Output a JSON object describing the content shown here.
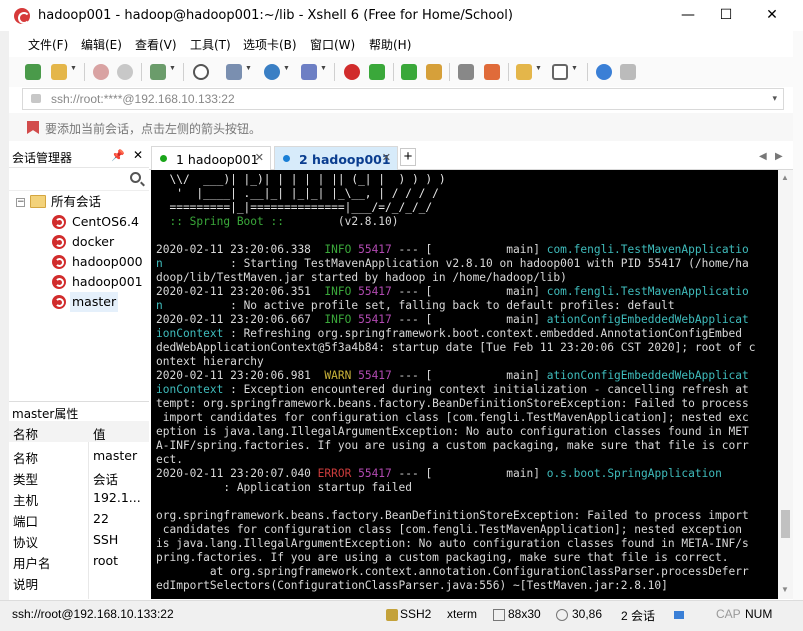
{
  "window": {
    "title": "hadoop001 - hadoop@hadoop001:~/lib - Xshell 6 (Free for Home/School)",
    "minimize": "—",
    "maximize": "☐",
    "close": "✕"
  },
  "menu": [
    "文件(F)",
    "编辑(E)",
    "查看(V)",
    "工具(T)",
    "选项卡(B)",
    "窗口(W)",
    "帮助(H)"
  ],
  "address": {
    "value": "ssh://root:****@192.168.10.133:22",
    "caret": "▾"
  },
  "hint": "要添加当前会话，点击左侧的箭头按钮。",
  "session_manager": {
    "title": "会话管理器",
    "pin": "📌",
    "close": "✕",
    "tree": {
      "root": "所有会话",
      "root_expander": "−",
      "items": [
        {
          "label": "CentOS6.4"
        },
        {
          "label": "docker"
        },
        {
          "label": "hadoop000"
        },
        {
          "label": "hadoop001"
        },
        {
          "label": "master"
        }
      ]
    }
  },
  "properties": {
    "title": "master属性",
    "header": {
      "name": "名称",
      "value": "值"
    },
    "rows": [
      {
        "name": "名称",
        "value": "master"
      },
      {
        "name": "类型",
        "value": "会话"
      },
      {
        "name": "主机",
        "value": "192.1..."
      },
      {
        "name": "端口",
        "value": "22"
      },
      {
        "name": "协议",
        "value": "SSH"
      },
      {
        "name": "用户名",
        "value": "root"
      },
      {
        "name": "说明",
        "value": ""
      }
    ]
  },
  "tabs": [
    {
      "label": "1 hadoop001",
      "close": "✕",
      "dot_color": "#1aa51a",
      "active": false
    },
    {
      "label": "2 hadoop001",
      "close": "✕",
      "dot_color": "#1a7fd6",
      "active": true
    }
  ],
  "tab_add": "+",
  "terminal": {
    "lines": [
      [
        {
          "t": "  \\\\/  ___)| |_)| | | | | || (_| |  ) ) ) )",
          "c": "c-banner"
        }
      ],
      [
        {
          "t": "   '  |____| .__|_| |_|_| |_\\__, | / / / /",
          "c": "c-banner"
        }
      ],
      [
        {
          "t": "  =========|_|==============|___/=/_/_/_/",
          "c": "c-banner"
        }
      ],
      [
        {
          "t": "  :: Spring Boot ::",
          "c": "c-green"
        },
        {
          "t": "        (v2.8.10)",
          "c": "c-gray"
        }
      ],
      [
        {
          "t": "",
          "c": "c-gray"
        }
      ],
      [
        {
          "t": "2020-02-11 23:20:06.338  ",
          "c": "c-gray"
        },
        {
          "t": "INFO",
          "c": "c-green"
        },
        {
          "t": " ",
          "c": "c-gray"
        },
        {
          "t": "55417",
          "c": "c-purple"
        },
        {
          "t": " --- [           main] ",
          "c": "c-gray"
        },
        {
          "t": "com.fengli.TestMavenApplicatio",
          "c": "c-cyan"
        }
      ],
      [
        {
          "t": "n",
          "c": "c-cyan"
        },
        {
          "t": "          : Starting TestMavenApplication v2.8.10 on hadoop001 with PID 55417 (/home/ha",
          "c": "c-gray"
        }
      ],
      [
        {
          "t": "doop/lib/TestMaven.jar started by hadoop in /home/hadoop/lib)",
          "c": "c-gray"
        }
      ],
      [
        {
          "t": "2020-02-11 23:20:06.351  ",
          "c": "c-gray"
        },
        {
          "t": "INFO",
          "c": "c-green"
        },
        {
          "t": " ",
          "c": "c-gray"
        },
        {
          "t": "55417",
          "c": "c-purple"
        },
        {
          "t": " --- [           main] ",
          "c": "c-gray"
        },
        {
          "t": "com.fengli.TestMavenApplicatio",
          "c": "c-cyan"
        }
      ],
      [
        {
          "t": "n",
          "c": "c-cyan"
        },
        {
          "t": "          : No active profile set, falling back to default profiles: default",
          "c": "c-gray"
        }
      ],
      [
        {
          "t": "2020-02-11 23:20:06.667  ",
          "c": "c-gray"
        },
        {
          "t": "INFO",
          "c": "c-green"
        },
        {
          "t": " ",
          "c": "c-gray"
        },
        {
          "t": "55417",
          "c": "c-purple"
        },
        {
          "t": " --- [           main] ",
          "c": "c-gray"
        },
        {
          "t": "ationConfigEmbeddedWebApplicat",
          "c": "c-cyan"
        }
      ],
      [
        {
          "t": "ionContext",
          "c": "c-cyan"
        },
        {
          "t": " : Refreshing org.springframework.boot.context.embedded.AnnotationConfigEmbed",
          "c": "c-gray"
        }
      ],
      [
        {
          "t": "dedWebApplicationContext@5f3a4b84: startup date [Tue Feb 11 23:20:06 CST 2020]; root of c",
          "c": "c-gray"
        }
      ],
      [
        {
          "t": "ontext hierarchy",
          "c": "c-gray"
        }
      ],
      [
        {
          "t": "2020-02-11 23:20:06.981  ",
          "c": "c-gray"
        },
        {
          "t": "WARN",
          "c": "c-yellow"
        },
        {
          "t": " ",
          "c": "c-gray"
        },
        {
          "t": "55417",
          "c": "c-purple"
        },
        {
          "t": " --- [           main] ",
          "c": "c-gray"
        },
        {
          "t": "ationConfigEmbeddedWebApplicat",
          "c": "c-cyan"
        }
      ],
      [
        {
          "t": "ionContext",
          "c": "c-cyan"
        },
        {
          "t": " : Exception encountered during context initialization - cancelling refresh at",
          "c": "c-gray"
        }
      ],
      [
        {
          "t": "tempt: org.springframework.beans.factory.BeanDefinitionStoreException: Failed to process",
          "c": "c-gray"
        }
      ],
      [
        {
          "t": " import candidates for configuration class [com.fengli.TestMavenApplication]; nested exc",
          "c": "c-gray"
        }
      ],
      [
        {
          "t": "eption is java.lang.IllegalArgumentException: No auto configuration classes found in MET",
          "c": "c-gray"
        }
      ],
      [
        {
          "t": "A-INF/spring.factories. If you are using a custom packaging, make sure that file is corr",
          "c": "c-gray"
        }
      ],
      [
        {
          "t": "ect.",
          "c": "c-gray"
        }
      ],
      [
        {
          "t": "2020-02-11 23:20:07.040 ",
          "c": "c-gray"
        },
        {
          "t": "ERROR",
          "c": "c-red"
        },
        {
          "t": " ",
          "c": "c-gray"
        },
        {
          "t": "55417",
          "c": "c-purple"
        },
        {
          "t": " --- [           main] ",
          "c": "c-gray"
        },
        {
          "t": "o.s.boot.SpringApplication",
          "c": "c-cyan"
        }
      ],
      [
        {
          "t": "          : Application startup failed",
          "c": "c-gray"
        }
      ],
      [
        {
          "t": "",
          "c": "c-gray"
        }
      ],
      [
        {
          "t": "org.springframework.beans.factory.BeanDefinitionStoreException: Failed to process import",
          "c": "c-gray"
        }
      ],
      [
        {
          "t": " candidates for configuration class [com.fengli.TestMavenApplication]; nested exception",
          "c": "c-gray"
        }
      ],
      [
        {
          "t": "is java.lang.IllegalArgumentException: No auto configuration classes found in META-INF/s",
          "c": "c-gray"
        }
      ],
      [
        {
          "t": "pring.factories. If you are using a custom packaging, make sure that file is correct.",
          "c": "c-gray"
        }
      ],
      [
        {
          "t": "        at org.springframework.context.annotation.ConfigurationClassParser.processDeferr",
          "c": "c-gray"
        }
      ],
      [
        {
          "t": "edImportSelectors(ConfigurationClassParser.java:556) ~[TestMaven.jar:2.8.10]",
          "c": "c-gray"
        }
      ]
    ]
  },
  "status": {
    "connection": "ssh://root@192.168.10.133:22",
    "protocol": "SSH2",
    "term": "xterm",
    "size": "88x30",
    "cursor": "30,86",
    "sessions": "2 会话",
    "caps": "CAP",
    "num": "NUM"
  },
  "colors": {
    "terminal_bg": "#000000",
    "active_tab": "#d7ebfa",
    "xshell_red": "#d12c2c"
  }
}
